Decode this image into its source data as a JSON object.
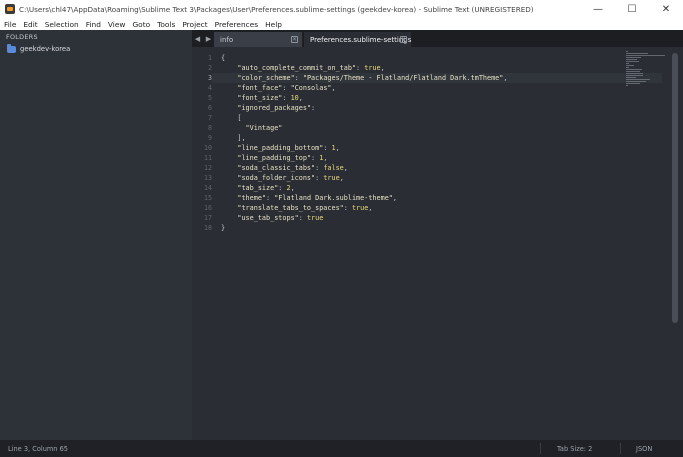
{
  "window": {
    "title": "C:\\Users\\chl47\\AppData\\Roaming\\Sublime Text 3\\Packages\\User\\Preferences.sublime-settings (geekdev-korea) - Sublime Text (UNREGISTERED)",
    "minimize_glyph": "—",
    "maximize_glyph": "☐",
    "close_glyph": "✕"
  },
  "menu": [
    "File",
    "Edit",
    "Selection",
    "Find",
    "View",
    "Goto",
    "Tools",
    "Project",
    "Preferences",
    "Help"
  ],
  "sidebar": {
    "header": "FOLDERS",
    "folder": "geekdev-korea"
  },
  "tabs": {
    "left_arrow": "◀",
    "right_arrow": "▶",
    "items": [
      {
        "label": "info",
        "close": "✕"
      },
      {
        "label": "Preferences.sublime-settings",
        "close": "✕"
      }
    ],
    "active_index": 1
  },
  "editor": {
    "line_numbers": [
      "1",
      "2",
      "3",
      "4",
      "5",
      "6",
      "7",
      "8",
      "9",
      "10",
      "11",
      "12",
      "13",
      "14",
      "15",
      "16",
      "17",
      "18"
    ],
    "active_line": 3,
    "lines": [
      [
        {
          "t": "{",
          "c": "punc"
        }
      ],
      [
        {
          "t": "    \"auto_complete_commit_on_tab\"",
          "c": "str"
        },
        {
          "t": ": ",
          "c": "punc"
        },
        {
          "t": "true",
          "c": "kw"
        },
        {
          "t": ",",
          "c": "punc"
        }
      ],
      [
        {
          "t": "    \"color_scheme\"",
          "c": "str"
        },
        {
          "t": ": ",
          "c": "punc"
        },
        {
          "t": "\"Packages/Theme - Flatland/Flatland Dark.tmTheme\"",
          "c": "str"
        },
        {
          "t": ",",
          "c": "punc"
        }
      ],
      [
        {
          "t": "    \"font_face\"",
          "c": "str"
        },
        {
          "t": ": ",
          "c": "punc"
        },
        {
          "t": "\"Consolas\"",
          "c": "str"
        },
        {
          "t": ",",
          "c": "punc"
        }
      ],
      [
        {
          "t": "    \"font_size\"",
          "c": "str"
        },
        {
          "t": ": ",
          "c": "punc"
        },
        {
          "t": "10",
          "c": "num"
        },
        {
          "t": ",",
          "c": "punc"
        }
      ],
      [
        {
          "t": "    \"ignored_packages\"",
          "c": "str"
        },
        {
          "t": ":",
          "c": "punc"
        }
      ],
      [
        {
          "t": "    [",
          "c": "punc"
        }
      ],
      [
        {
          "t": "      \"Vintage\"",
          "c": "str"
        }
      ],
      [
        {
          "t": "    ],",
          "c": "punc"
        }
      ],
      [
        {
          "t": "    \"line_padding_bottom\"",
          "c": "str"
        },
        {
          "t": ": ",
          "c": "punc"
        },
        {
          "t": "1",
          "c": "num"
        },
        {
          "t": ",",
          "c": "punc"
        }
      ],
      [
        {
          "t": "    \"line_padding_top\"",
          "c": "str"
        },
        {
          "t": ": ",
          "c": "punc"
        },
        {
          "t": "1",
          "c": "num"
        },
        {
          "t": ",",
          "c": "punc"
        }
      ],
      [
        {
          "t": "    \"soda_classic_tabs\"",
          "c": "str"
        },
        {
          "t": ": ",
          "c": "punc"
        },
        {
          "t": "false",
          "c": "kw"
        },
        {
          "t": ",",
          "c": "punc"
        }
      ],
      [
        {
          "t": "    \"soda_folder_icons\"",
          "c": "str"
        },
        {
          "t": ": ",
          "c": "punc"
        },
        {
          "t": "true",
          "c": "kw"
        },
        {
          "t": ",",
          "c": "punc"
        }
      ],
      [
        {
          "t": "    \"tab_size\"",
          "c": "str"
        },
        {
          "t": ": ",
          "c": "punc"
        },
        {
          "t": "2",
          "c": "num"
        },
        {
          "t": ",",
          "c": "punc"
        }
      ],
      [
        {
          "t": "    \"theme\"",
          "c": "str"
        },
        {
          "t": ": ",
          "c": "punc"
        },
        {
          "t": "\"Flatland Dark.sublime-theme\"",
          "c": "str"
        },
        {
          "t": ",",
          "c": "punc"
        }
      ],
      [
        {
          "t": "    \"translate_tabs_to_spaces\"",
          "c": "str"
        },
        {
          "t": ": ",
          "c": "punc"
        },
        {
          "t": "true",
          "c": "kw"
        },
        {
          "t": ",",
          "c": "punc"
        }
      ],
      [
        {
          "t": "    \"use_tab_stops\"",
          "c": "str"
        },
        {
          "t": ": ",
          "c": "punc"
        },
        {
          "t": "true",
          "c": "kw"
        }
      ],
      [
        {
          "t": "}",
          "c": "punc"
        }
      ]
    ]
  },
  "status": {
    "position": "Line 3, Column 65",
    "tab_size": "Tab Size: 2",
    "syntax": "JSON"
  },
  "colors": {
    "editor_bg": "#2a2d33",
    "sidebar_bg": "#2d3138",
    "string": "#e6e2c4",
    "keyword": "#eadb7a"
  }
}
